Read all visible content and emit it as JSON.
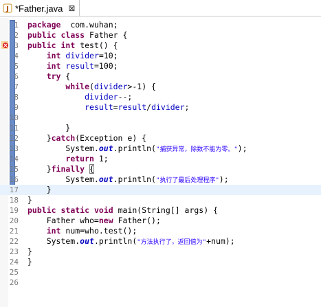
{
  "tab": {
    "title": "*Father.java",
    "close_glyph": "⊠",
    "icon": "java-file-icon"
  },
  "current_line": 17,
  "error_line": 3,
  "lines": [
    {
      "n": "1",
      "t": [
        [
          "kw",
          "package"
        ],
        [
          "",
          "  com.wuhan;"
        ]
      ]
    },
    {
      "n": "2",
      "t": [
        [
          "kw",
          "public"
        ],
        [
          "",
          " "
        ],
        [
          "kw",
          "class"
        ],
        [
          "",
          " Father {"
        ]
      ]
    },
    {
      "n": "3",
      "t": [
        [
          "kw",
          "public"
        ],
        [
          "",
          " "
        ],
        [
          "kw",
          "int"
        ],
        [
          "",
          " test() {"
        ]
      ]
    },
    {
      "n": "4",
      "t": [
        [
          "",
          "    "
        ],
        [
          "kw",
          "int"
        ],
        [
          "",
          " "
        ],
        [
          "fld",
          "divider"
        ],
        [
          "",
          "=10;"
        ]
      ]
    },
    {
      "n": "5",
      "t": [
        [
          "",
          "    "
        ],
        [
          "kw",
          "int"
        ],
        [
          "",
          " "
        ],
        [
          "fld",
          "result"
        ],
        [
          "",
          "=100;"
        ]
      ]
    },
    {
      "n": "6",
      "t": [
        [
          "",
          "    "
        ],
        [
          "kw",
          "try"
        ],
        [
          "",
          " {"
        ]
      ]
    },
    {
      "n": "7",
      "t": [
        [
          "",
          "        "
        ],
        [
          "kw",
          "while"
        ],
        [
          "",
          "("
        ],
        [
          "fld",
          "divider"
        ],
        [
          "",
          ">-1) {"
        ]
      ]
    },
    {
      "n": "8",
      "t": [
        [
          "",
          "            "
        ],
        [
          "fld",
          "divider"
        ],
        [
          "",
          "--;"
        ]
      ]
    },
    {
      "n": "9",
      "t": [
        [
          "",
          "            "
        ],
        [
          "fld",
          "result"
        ],
        [
          "",
          "="
        ],
        [
          "fld",
          "result"
        ],
        [
          "",
          "/"
        ],
        [
          "fld",
          "divider"
        ],
        [
          "",
          ";"
        ]
      ]
    },
    {
      "n": "10",
      "t": []
    },
    {
      "n": "11",
      "t": [
        [
          "",
          "        }"
        ]
      ]
    },
    {
      "n": "12",
      "t": [
        [
          "",
          "    }"
        ],
        [
          "kw",
          "catch"
        ],
        [
          "",
          "(Exception e) {"
        ]
      ]
    },
    {
      "n": "13",
      "t": [
        [
          "",
          "        System."
        ],
        [
          "st",
          "out"
        ],
        [
          "",
          ".println("
        ],
        [
          "str",
          "\"捕获异常，除数不能为零。\""
        ],
        [
          "",
          ");"
        ]
      ]
    },
    {
      "n": "14",
      "t": [
        [
          "",
          "        "
        ],
        [
          "kw",
          "return"
        ],
        [
          "",
          " 1;"
        ]
      ]
    },
    {
      "n": "15",
      "t": [
        [
          "",
          "    }"
        ],
        [
          "kw",
          "finally"
        ],
        [
          "",
          " "
        ],
        [
          "box",
          "{"
        ]
      ]
    },
    {
      "n": "16",
      "t": [
        [
          "",
          "        System."
        ],
        [
          "st",
          "out"
        ],
        [
          "",
          ".println("
        ],
        [
          "str",
          "\"执行了最后处理程序\""
        ],
        [
          "",
          ");"
        ]
      ]
    },
    {
      "n": "17",
      "t": [
        [
          "",
          "    }"
        ]
      ]
    },
    {
      "n": "18",
      "t": [
        [
          "",
          "}"
        ]
      ]
    },
    {
      "n": "19",
      "t": [
        [
          "kw",
          "public"
        ],
        [
          "",
          " "
        ],
        [
          "kw",
          "static"
        ],
        [
          "",
          " "
        ],
        [
          "kw",
          "void"
        ],
        [
          "",
          " main(String[] args) {"
        ]
      ]
    },
    {
      "n": "20",
      "t": [
        [
          "",
          "    Father who="
        ],
        [
          "kw",
          "new"
        ],
        [
          "",
          " Father();"
        ]
      ]
    },
    {
      "n": "21",
      "t": [
        [
          "",
          "    "
        ],
        [
          "kw",
          "int"
        ],
        [
          "",
          " num=who.test();"
        ]
      ]
    },
    {
      "n": "22",
      "t": [
        [
          "",
          "    System."
        ],
        [
          "st",
          "out"
        ],
        [
          "",
          ".println("
        ],
        [
          "str",
          "\"方法执行了，返回值为\""
        ],
        [
          "",
          "+num);"
        ]
      ]
    },
    {
      "n": "23",
      "t": [
        [
          "",
          "}"
        ]
      ]
    },
    {
      "n": "24",
      "t": [
        [
          "",
          "}"
        ]
      ]
    },
    {
      "n": "25",
      "t": []
    },
    {
      "n": "26",
      "t": []
    }
  ]
}
